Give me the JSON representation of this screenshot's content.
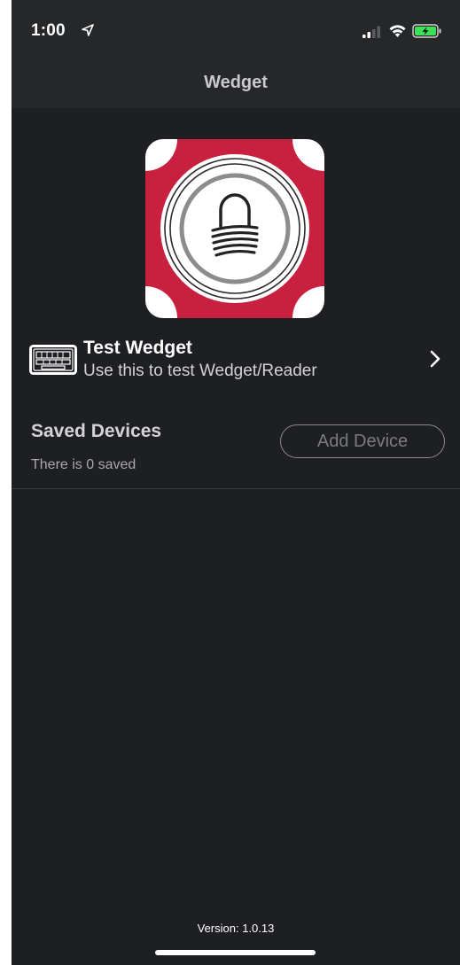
{
  "status_bar": {
    "time": "1:00",
    "icons": [
      "location-arrow-icon",
      "cellular-signal-icon",
      "wifi-icon",
      "battery-charging-icon"
    ]
  },
  "nav": {
    "title": "Wedget"
  },
  "logo": {
    "icon": "wedget-lock-logo-icon",
    "colors": {
      "background": "#c8203f",
      "ring": "#ffffff",
      "inner_ring": "#8c8c8c"
    }
  },
  "test_wedget": {
    "title": "Test Wedget",
    "subtitle": "Use this to test Wedget/Reader",
    "icon": "keyboard-icon"
  },
  "saved_devices": {
    "title": "Saved Devices",
    "count_text": "There is 0 saved",
    "add_button_label": "Add Device"
  },
  "footer": {
    "version": "Version: 1.0.13"
  },
  "colors": {
    "background": "#1e1f22",
    "bar_background": "#262729",
    "text_primary": "#ffffff",
    "text_secondary": "#d3d3d6",
    "button_border": "#8a8a8e"
  }
}
